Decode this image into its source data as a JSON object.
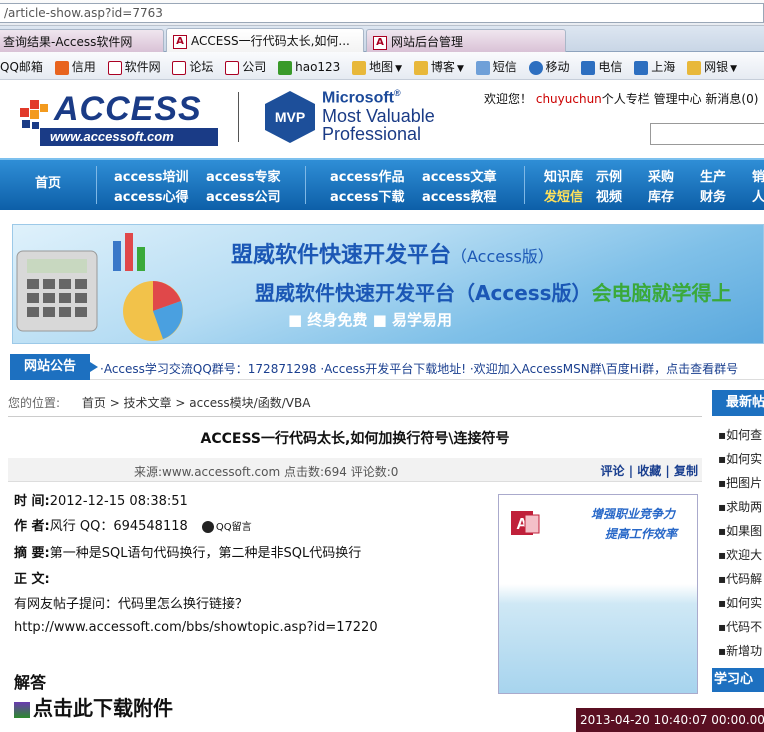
{
  "address_bar": {
    "url": "/article-show.asp?id=7763"
  },
  "tabs": [
    {
      "label": "查询结果-Access软件网"
    },
    {
      "label": "ACCESS一行代码太长,如何..."
    },
    {
      "label": "网站后台管理"
    }
  ],
  "favorites": [
    {
      "label": "QQ邮箱"
    },
    {
      "label": "信用"
    },
    {
      "label": "软件网"
    },
    {
      "label": "论坛"
    },
    {
      "label": "公司"
    },
    {
      "label": "hao123"
    },
    {
      "label": "地图"
    },
    {
      "label": "博客"
    },
    {
      "label": "短信"
    },
    {
      "label": "移动"
    },
    {
      "label": "电信"
    },
    {
      "label": "上海"
    },
    {
      "label": "网银"
    }
  ],
  "header": {
    "logo_text": "ACCESS",
    "logo_url": "www.accessoft.com",
    "mvp_badge": "MVP",
    "ms_line1": "Microsoft",
    "ms_reg": "®",
    "ms_line2": "Most Valuable",
    "ms_line3": "Professional",
    "welcome_prefix": "欢迎您！",
    "username": "chuyuchun",
    "welcome_links": "个人专栏  管理中心  新消息(0)"
  },
  "nav": {
    "home": "首页",
    "items": [
      {
        "label": "access培训"
      },
      {
        "label": "access专家"
      },
      {
        "label": "access心得"
      },
      {
        "label": "access公司"
      },
      {
        "label": "access作品"
      },
      {
        "label": "access文章"
      },
      {
        "label": "access下载"
      },
      {
        "label": "access教程"
      },
      {
        "label": "知识库"
      },
      {
        "label": "示例"
      },
      {
        "label": "采购"
      },
      {
        "label": "生产"
      },
      {
        "label": "销"
      },
      {
        "label": "发短信"
      },
      {
        "label": "视频"
      },
      {
        "label": "库存"
      },
      {
        "label": "财务"
      },
      {
        "label": "人"
      }
    ]
  },
  "banner": {
    "line1": "盟威软件快速开发平台",
    "line1_suffix": "（Access版）",
    "line2": "盟威软件快速开发平台（Access版）",
    "line2_green": "会电脑就学得上",
    "line3": "■ 终身免费   ■ 易学易用"
  },
  "notice": {
    "label": "网站公告",
    "text": "·Access学习交流QQ群号：172871298    ·Access开发平台下载地址!    ·欢迎加入AccessMSN群\\百度Hi群，点击查看群号"
  },
  "breadcrumb": {
    "prefix": "您的位置:",
    "path": "首页 > 技术文章 > access模块/函数/VBA"
  },
  "article": {
    "title": "ACCESS一行代码太长,如何加换行符号\\连接符号",
    "source": "来源:www.accessoft.com  点击数:694  评论数:0",
    "actions": "评论 | 收藏 | 复制",
    "time_label": "时  间:",
    "time_value": "2012-12-15 08:38:51",
    "author_label": "作  者:",
    "author_value": "风行   QQ：694548118",
    "qq_msg": "QQ留言",
    "summary_label": "摘  要:",
    "summary_value": "第一种是SQL语句代码换行，第二种是非SQL代码换行",
    "body_label": "正  文:",
    "body_line1": "有网友帖子提问：代码里怎么换行链接？",
    "body_line2": "http://www.accessoft.com/bbs/showtopic.asp?id=17220",
    "answer": "解答",
    "download": "点击此下载附件"
  },
  "ad": {
    "line1": "增强职业竞争力",
    "line2": "提高工作效率"
  },
  "right_panel": {
    "header": "最新帖",
    "items": [
      "如何查",
      "如何实",
      "把图片",
      "求助两",
      "如果图",
      "欢迎大",
      "代码解",
      "如何实",
      "代码不",
      "新增功"
    ],
    "header2": "学习心"
  },
  "clock": "2013-04-20 10:40:07 00:00.000"
}
